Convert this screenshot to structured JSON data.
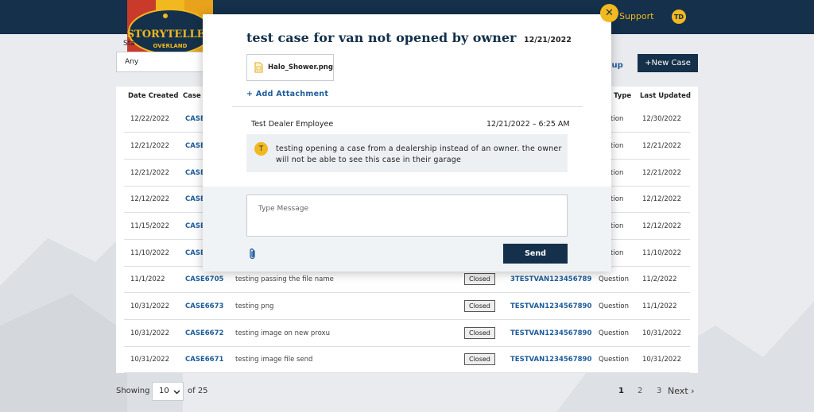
{
  "header": {
    "support_label": "Support",
    "user_initials": "TD",
    "logo_text_top": "STORYTELLER",
    "logo_text_bottom": "OVERLAND"
  },
  "filters": {
    "status_label": "Sta",
    "status_value": "Any",
    "vin_lookup_label": "okup",
    "new_case_label": "+New Case"
  },
  "table": {
    "headers": {
      "date_created": "Date Created",
      "case_number": "Case N",
      "type": "Type",
      "last_updated": "Last Updated"
    },
    "rows": [
      {
        "date": "12/22/2022",
        "case": "CASE",
        "subject": "",
        "status": "",
        "vin": "",
        "type": "uestion",
        "updated": "12/30/2022"
      },
      {
        "date": "12/21/2022",
        "case": "CASE",
        "subject": "",
        "status": "",
        "vin": "",
        "type": "uestion",
        "updated": "12/21/2022"
      },
      {
        "date": "12/21/2022",
        "case": "CASE",
        "subject": "",
        "status": "",
        "vin": "",
        "type": "uestion",
        "updated": "12/21/2022"
      },
      {
        "date": "12/12/2022",
        "case": "CASE",
        "subject": "",
        "status": "",
        "vin": "",
        "type": "uestion",
        "updated": "12/12/2022"
      },
      {
        "date": "11/15/2022",
        "case": "CASE",
        "subject": "",
        "status": "",
        "vin": "",
        "type": "uestion",
        "updated": "12/12/2022"
      },
      {
        "date": "11/10/2022",
        "case": "CASE",
        "subject": "",
        "status": "",
        "vin": "",
        "type": "uestion",
        "updated": "11/10/2022"
      },
      {
        "date": "11/1/2022",
        "case": "CASE6705",
        "subject": "testing passing the file name",
        "status": "Closed",
        "vin": "3TESTVAN123456789",
        "type": "Question",
        "updated": "11/2/2022"
      },
      {
        "date": "10/31/2022",
        "case": "CASE6673",
        "subject": "testing png",
        "status": "Closed",
        "vin": "TESTVAN1234567890",
        "type": "Question",
        "updated": "11/1/2022"
      },
      {
        "date": "10/31/2022",
        "case": "CASE6672",
        "subject": "testing image on new proxu",
        "status": "Closed",
        "vin": "TESTVAN1234567890",
        "type": "Question",
        "updated": "10/31/2022"
      },
      {
        "date": "10/31/2022",
        "case": "CASE6671",
        "subject": "testing image file send",
        "status": "Closed",
        "vin": "TESTVAN1234567890",
        "type": "Question",
        "updated": "10/31/2022"
      }
    ]
  },
  "pagination": {
    "showing_label": "Showing",
    "page_size": "10",
    "of_total": "of 25",
    "pages": [
      "1",
      "2",
      "3"
    ],
    "next_label": "Next"
  },
  "modal": {
    "title": "test case for van not opened by owner",
    "date": "12/21/2022",
    "attachment_name": "Halo_Shower.png",
    "add_attachment_label": "+ Add Attachment",
    "message": {
      "author": "Test Dealer Employee",
      "timestamp": "12/21/2022 – 6:25 AM",
      "avatar_initial": "T",
      "text": "testing opening a case from a dealership instead of an owner. the owner will not be able to see this case in their garage"
    },
    "compose_placeholder": "Type Message",
    "send_label": "Send"
  },
  "colors": {
    "navy": "#14304a",
    "gold": "#f2b81f",
    "link_blue": "#1e5c9b"
  }
}
